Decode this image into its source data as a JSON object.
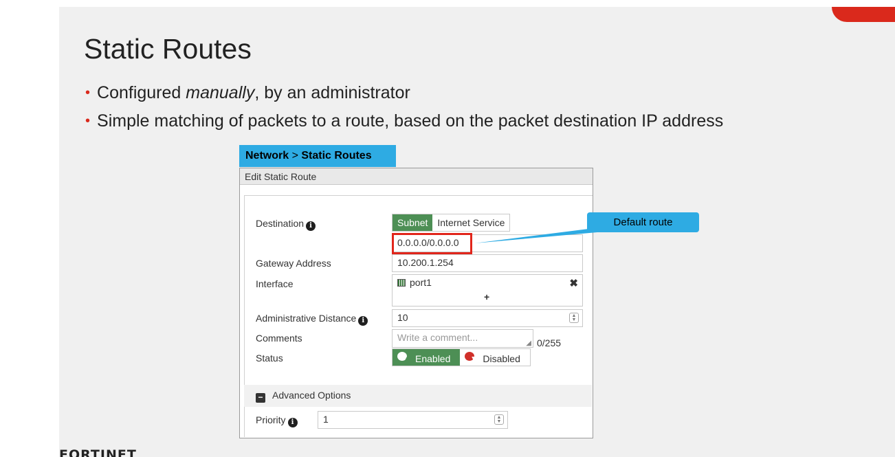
{
  "slide": {
    "title": "Static Routes",
    "bullets": [
      {
        "before": "Configured ",
        "em": "manually",
        "after": ", by an administrator"
      },
      {
        "before": "Simple matching of packets to a route, based on the packet destination IP address",
        "em": "",
        "after": ""
      }
    ],
    "bullet_char": "•",
    "logo_text": "FORTINET",
    "accent_color": "#da291c"
  },
  "breadcrumb": {
    "part1": "Network",
    "sep": " > ",
    "part2": "Static Routes"
  },
  "panel": {
    "header": "Edit Static Route",
    "destination": {
      "label": "Destination",
      "options": [
        "Subnet",
        "Internet Service"
      ],
      "selected": "Subnet",
      "value": "0.0.0.0/0.0.0.0"
    },
    "gateway": {
      "label": "Gateway Address",
      "value": "10.200.1.254"
    },
    "interface": {
      "label": "Interface",
      "value": "port1",
      "add_symbol": "+",
      "remove_symbol": "✖"
    },
    "admin_distance": {
      "label": "Administrative Distance",
      "value": "10"
    },
    "comments": {
      "label": "Comments",
      "placeholder": "Write a comment...",
      "counter": "0/255"
    },
    "status": {
      "label": "Status",
      "enabled_label": "Enabled",
      "disabled_label": "Disabled",
      "selected": "Enabled"
    },
    "advanced": {
      "label": "Advanced Options"
    },
    "priority": {
      "label": "Priority",
      "value": "1"
    }
  },
  "callout": {
    "text": "Default route"
  },
  "colors": {
    "callout_blue": "#2eabe3",
    "toggle_green": "#4d8f55",
    "highlight_red": "#e1251b"
  }
}
